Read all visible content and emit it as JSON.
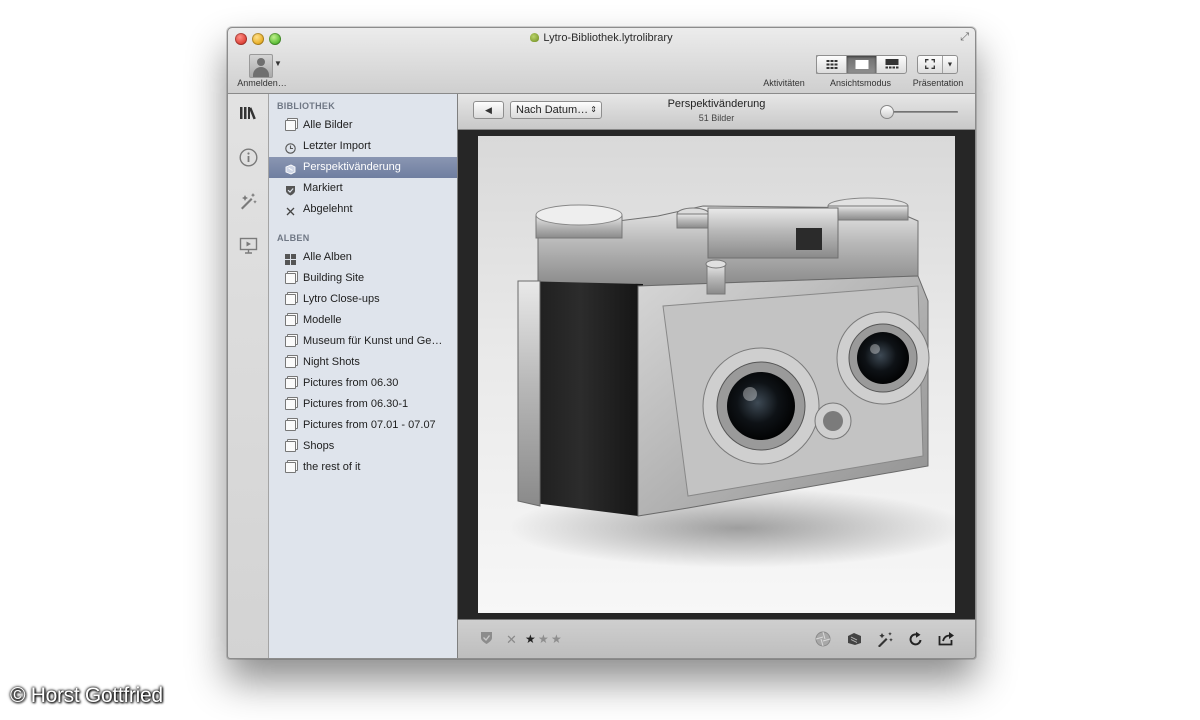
{
  "window": {
    "title": "Lytro-Bibliothek.lytrolibrary"
  },
  "toolbar": {
    "account_label": "Anmelden…",
    "activities_label": "Aktivitäten",
    "view_mode_label": "Ansichtsmodus",
    "presentation_label": "Präsentation",
    "active_view_mode": "single"
  },
  "rail": {
    "icons": [
      "library-icon",
      "info-icon",
      "adjust-icon",
      "slideshow-icon"
    ]
  },
  "sidebar": {
    "library_heading": "BIBLIOTHEK",
    "library_items": [
      {
        "label": "Alle Bilder",
        "icon": "stack-icon"
      },
      {
        "label": "Letzter Import",
        "icon": "clock-icon"
      },
      {
        "label": "Perspektivänderung",
        "icon": "perspective-icon",
        "selected": true
      },
      {
        "label": "Markiert",
        "icon": "flag-shield-icon"
      },
      {
        "label": "Abgelehnt",
        "icon": "x-icon"
      }
    ],
    "albums_heading": "ALBEN",
    "album_items": [
      {
        "label": "Alle Alben",
        "icon": "grid-icon"
      },
      {
        "label": "Building Site",
        "icon": "stack-icon"
      },
      {
        "label": "Lytro Close-ups",
        "icon": "stack-icon"
      },
      {
        "label": "Modelle",
        "icon": "stack-icon"
      },
      {
        "label": "Museum für Kunst und Ge…",
        "icon": "stack-icon"
      },
      {
        "label": "Night Shots",
        "icon": "stack-icon"
      },
      {
        "label": "Pictures from 06.30",
        "icon": "stack-icon"
      },
      {
        "label": "Pictures from 06.30-1",
        "icon": "stack-icon"
      },
      {
        "label": "Pictures from 07.01 - 07.07",
        "icon": "stack-icon"
      },
      {
        "label": "Shops",
        "icon": "stack-icon"
      },
      {
        "label": "the rest of it",
        "icon": "stack-icon"
      }
    ]
  },
  "main": {
    "back_label": "◀",
    "sort_label": "Nach Datum…",
    "title": "Perspektivänderung",
    "subtitle": "51 Bilder",
    "zoom_level": 0.0,
    "photo_subject": "stereo camera"
  },
  "bottom": {
    "rating": 1,
    "max_rating": 3,
    "left_icons": [
      "flag-shield-icon",
      "reject-x-icon"
    ],
    "right_icons": [
      "living-picture-icon",
      "layers-icon",
      "magic-wand-icon",
      "rotate-icon",
      "share-icon"
    ]
  },
  "watermark": "© Horst Gottfried",
  "colors": {
    "selection": "#7583a4",
    "sidebar_bg": "#dfe4ec",
    "main_bg": "#262626"
  }
}
